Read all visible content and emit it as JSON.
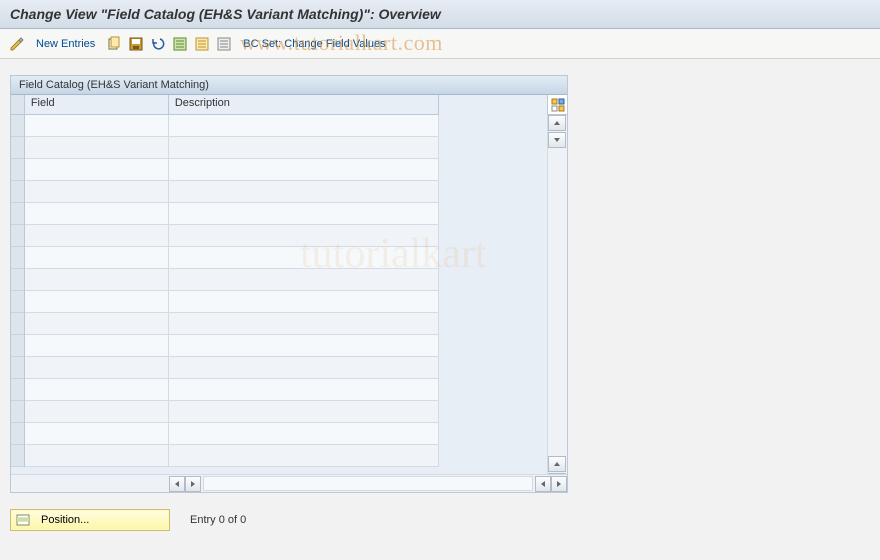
{
  "title": "Change View \"Field Catalog (EH&S Variant Matching)\": Overview",
  "toolbar": {
    "new_entries": "New Entries",
    "bc_set": "BC Set: Change Field Values"
  },
  "panel": {
    "title": "Field Catalog (EH&S Variant Matching)",
    "columns": {
      "field": "Field",
      "description": "Description"
    },
    "rows": [
      {
        "field": "",
        "description": ""
      },
      {
        "field": "",
        "description": ""
      },
      {
        "field": "",
        "description": ""
      },
      {
        "field": "",
        "description": ""
      },
      {
        "field": "",
        "description": ""
      },
      {
        "field": "",
        "description": ""
      },
      {
        "field": "",
        "description": ""
      },
      {
        "field": "",
        "description": ""
      },
      {
        "field": "",
        "description": ""
      },
      {
        "field": "",
        "description": ""
      },
      {
        "field": "",
        "description": ""
      },
      {
        "field": "",
        "description": ""
      },
      {
        "field": "",
        "description": ""
      },
      {
        "field": "",
        "description": ""
      },
      {
        "field": "",
        "description": ""
      },
      {
        "field": "",
        "description": ""
      }
    ]
  },
  "footer": {
    "position_label": "Position...",
    "entry_text": "Entry 0 of 0"
  },
  "watermark": "www.tutorialkart.com",
  "watermark_faint": "tutorialkart"
}
